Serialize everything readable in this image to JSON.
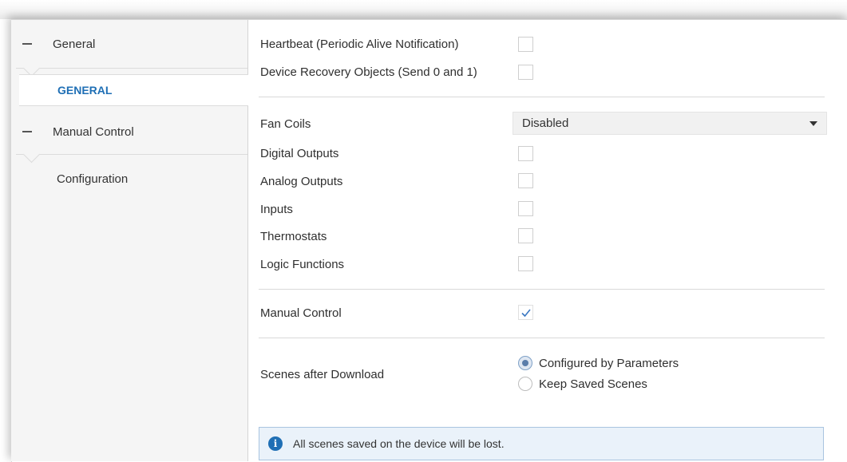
{
  "sidebar": {
    "groups": [
      {
        "label": "General",
        "items": [
          {
            "label": "GENERAL",
            "active": true
          }
        ]
      },
      {
        "label": "Manual Control",
        "items": [
          {
            "label": "Configuration",
            "active": false
          }
        ]
      }
    ]
  },
  "main": {
    "heartbeat": {
      "label": "Heartbeat (Periodic Alive Notification)",
      "checked": false
    },
    "recovery": {
      "label": "Device Recovery Objects (Send 0 and 1)",
      "checked": false
    },
    "fan_coils": {
      "label": "Fan Coils",
      "value": "Disabled"
    },
    "digital_outputs": {
      "label": "Digital Outputs",
      "checked": false
    },
    "analog_outputs": {
      "label": "Analog Outputs",
      "checked": false
    },
    "inputs": {
      "label": "Inputs",
      "checked": false
    },
    "thermostats": {
      "label": "Thermostats",
      "checked": false
    },
    "logic_functions": {
      "label": "Logic Functions",
      "checked": false
    },
    "manual_control": {
      "label": "Manual Control",
      "checked": true
    },
    "scenes": {
      "label": "Scenes after Download",
      "options": [
        "Configured by Parameters",
        "Keep Saved Scenes"
      ],
      "selected": "Configured by Parameters"
    },
    "info": {
      "icon": "info-icon",
      "text": "All scenes saved on the device will be lost."
    }
  },
  "colors": {
    "accent": "#1f6fb5",
    "sidebar_bg": "#f5f5f5",
    "info_bg": "#eaf2fa"
  }
}
